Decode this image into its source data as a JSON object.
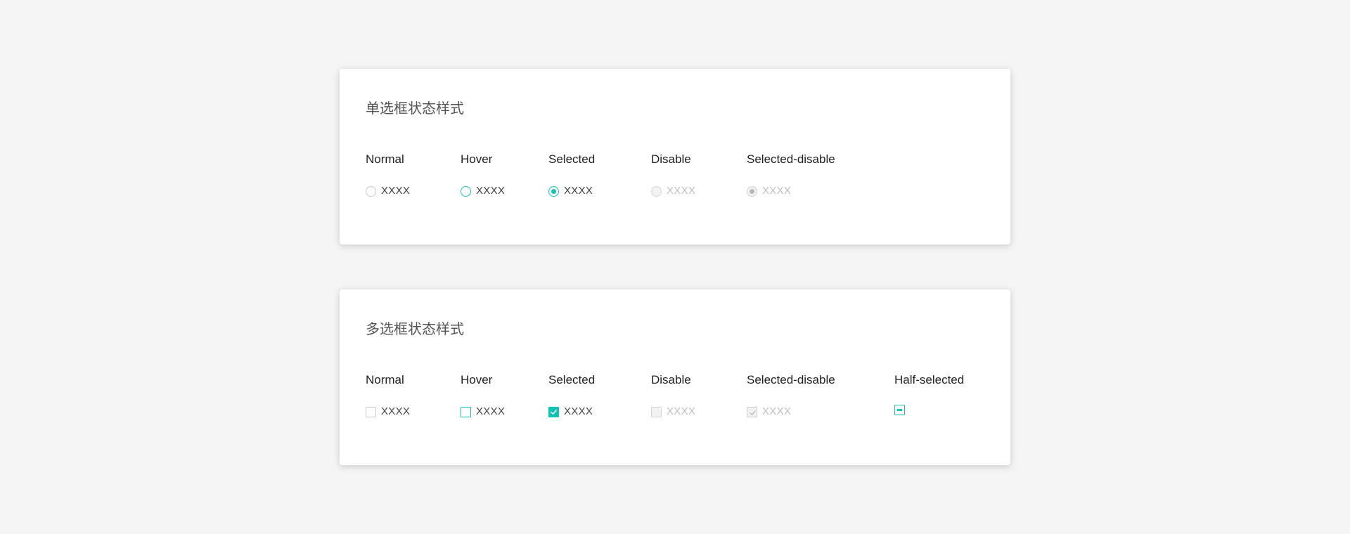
{
  "colors": {
    "accent": "#12c2b2",
    "background": "#f5f5f5",
    "card": "#ffffff",
    "disabled_text": "#bfbfbf"
  },
  "radio_section": {
    "title": "单选框状态样式",
    "columns": [
      {
        "label": "Normal",
        "option_text": "XXXX",
        "state": "normal"
      },
      {
        "label": "Hover",
        "option_text": "XXXX",
        "state": "hover"
      },
      {
        "label": "Selected",
        "option_text": "XXXX",
        "state": "selected"
      },
      {
        "label": "Disable",
        "option_text": "XXXX",
        "state": "disabled"
      },
      {
        "label": "Selected-disable",
        "option_text": "XXXX",
        "state": "selected-disabled"
      }
    ]
  },
  "checkbox_section": {
    "title": "多选框状态样式",
    "columns": [
      {
        "label": "Normal",
        "option_text": "XXXX",
        "state": "normal"
      },
      {
        "label": "Hover",
        "option_text": "XXXX",
        "state": "hover"
      },
      {
        "label": "Selected",
        "option_text": "XXXX",
        "state": "selected"
      },
      {
        "label": "Disable",
        "option_text": "XXXX",
        "state": "disabled"
      },
      {
        "label": "Selected-disable",
        "option_text": "XXXX",
        "state": "selected-disabled"
      },
      {
        "label": "Half-selected",
        "state": "half-selected"
      }
    ]
  }
}
